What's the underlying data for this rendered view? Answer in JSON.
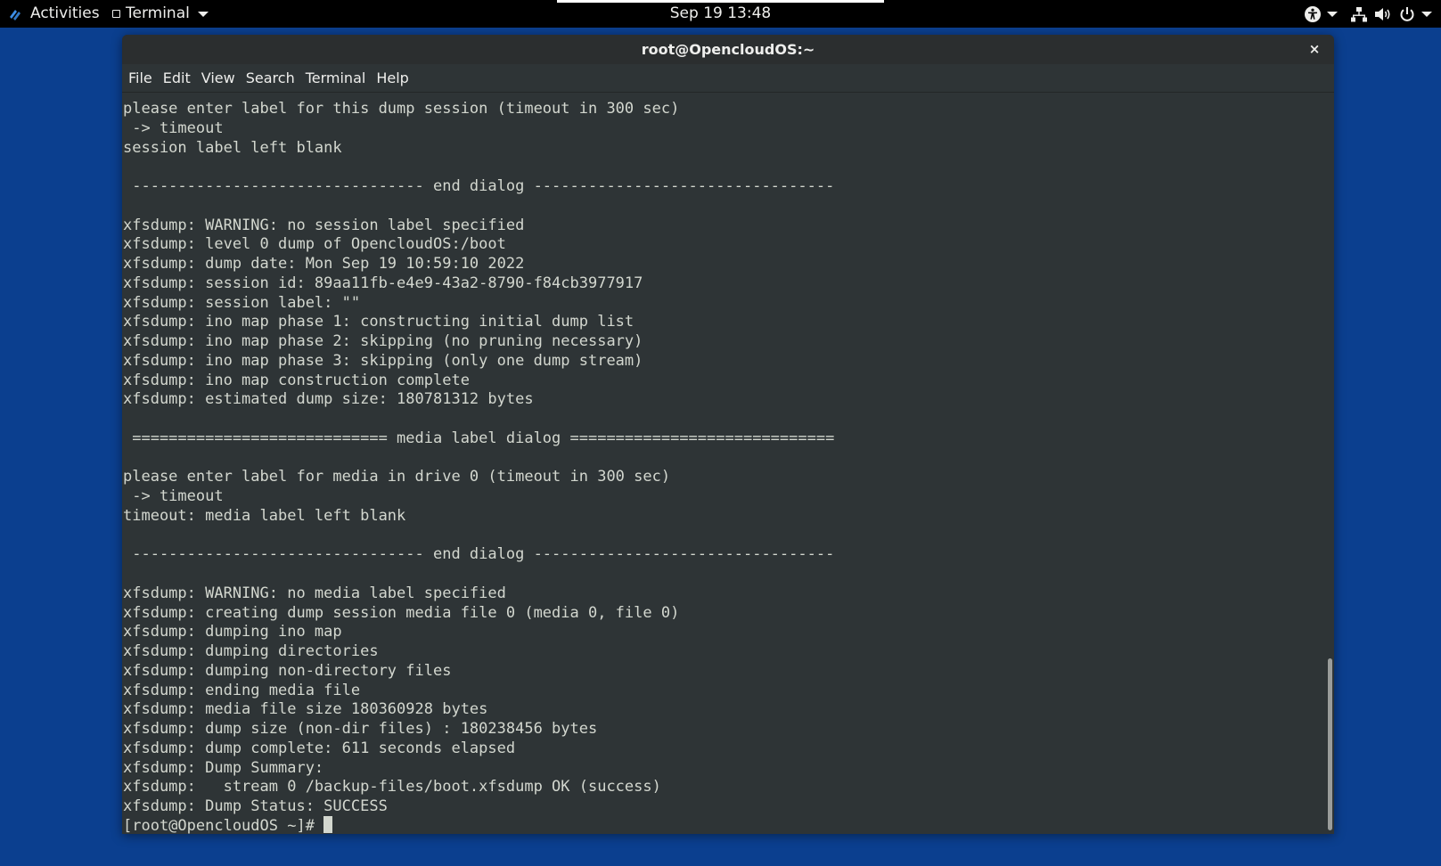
{
  "topbar": {
    "activities": "Activities",
    "app_name": "Terminal",
    "clock": "Sep 19  13:48"
  },
  "window": {
    "title": "root@OpencloudOS:~",
    "close_glyph": "×",
    "menus": [
      "File",
      "Edit",
      "View",
      "Search",
      "Terminal",
      "Help"
    ]
  },
  "terminal": {
    "lines": [
      "please enter label for this dump session (timeout in 300 sec)",
      " -> timeout",
      "session label left blank",
      "",
      " -------------------------------- end dialog ---------------------------------",
      "",
      "xfsdump: WARNING: no session label specified",
      "xfsdump: level 0 dump of OpencloudOS:/boot",
      "xfsdump: dump date: Mon Sep 19 10:59:10 2022",
      "xfsdump: session id: 89aa11fb-e4e9-43a2-8790-f84cb3977917",
      "xfsdump: session label: \"\"",
      "xfsdump: ino map phase 1: constructing initial dump list",
      "xfsdump: ino map phase 2: skipping (no pruning necessary)",
      "xfsdump: ino map phase 3: skipping (only one dump stream)",
      "xfsdump: ino map construction complete",
      "xfsdump: estimated dump size: 180781312 bytes",
      "",
      " ============================ media label dialog =============================",
      "",
      "please enter label for media in drive 0 (timeout in 300 sec)",
      " -> timeout",
      "timeout: media label left blank",
      "",
      " -------------------------------- end dialog ---------------------------------",
      "",
      "xfsdump: WARNING: no media label specified",
      "xfsdump: creating dump session media file 0 (media 0, file 0)",
      "xfsdump: dumping ino map",
      "xfsdump: dumping directories",
      "xfsdump: dumping non-directory files",
      "xfsdump: ending media file",
      "xfsdump: media file size 180360928 bytes",
      "xfsdump: dump size (non-dir files) : 180238456 bytes",
      "xfsdump: dump complete: 611 seconds elapsed",
      "xfsdump: Dump Summary:",
      "xfsdump:   stream 0 /backup-files/boot.xfsdump OK (success)",
      "xfsdump: Dump Status: SUCCESS"
    ],
    "prompt": "[root@OpencloudOS ~]# "
  },
  "colors": {
    "desktop": "#0b3f8f",
    "terminal_bg": "#2e3436",
    "terminal_fg": "#d3d7cf",
    "topbar_bg": "#000000"
  },
  "icons": [
    "activities-icon",
    "app-icon",
    "accessibility-icon",
    "network-icon",
    "volume-icon",
    "power-icon"
  ]
}
